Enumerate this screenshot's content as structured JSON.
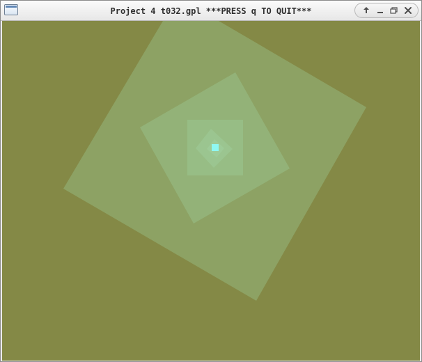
{
  "window": {
    "title": "Project 4 t032.gpl ***PRESS q TO QUIT***"
  },
  "icons": {
    "app": "window-icon",
    "keep_above": "arrow-up-icon",
    "minimize": "minimize-icon",
    "maximize": "restore-icon",
    "close": "close-icon"
  },
  "canvas": {
    "background": "#848946",
    "square_fill": "#a2d3a1",
    "core_fill": "#8ff8f2"
  }
}
